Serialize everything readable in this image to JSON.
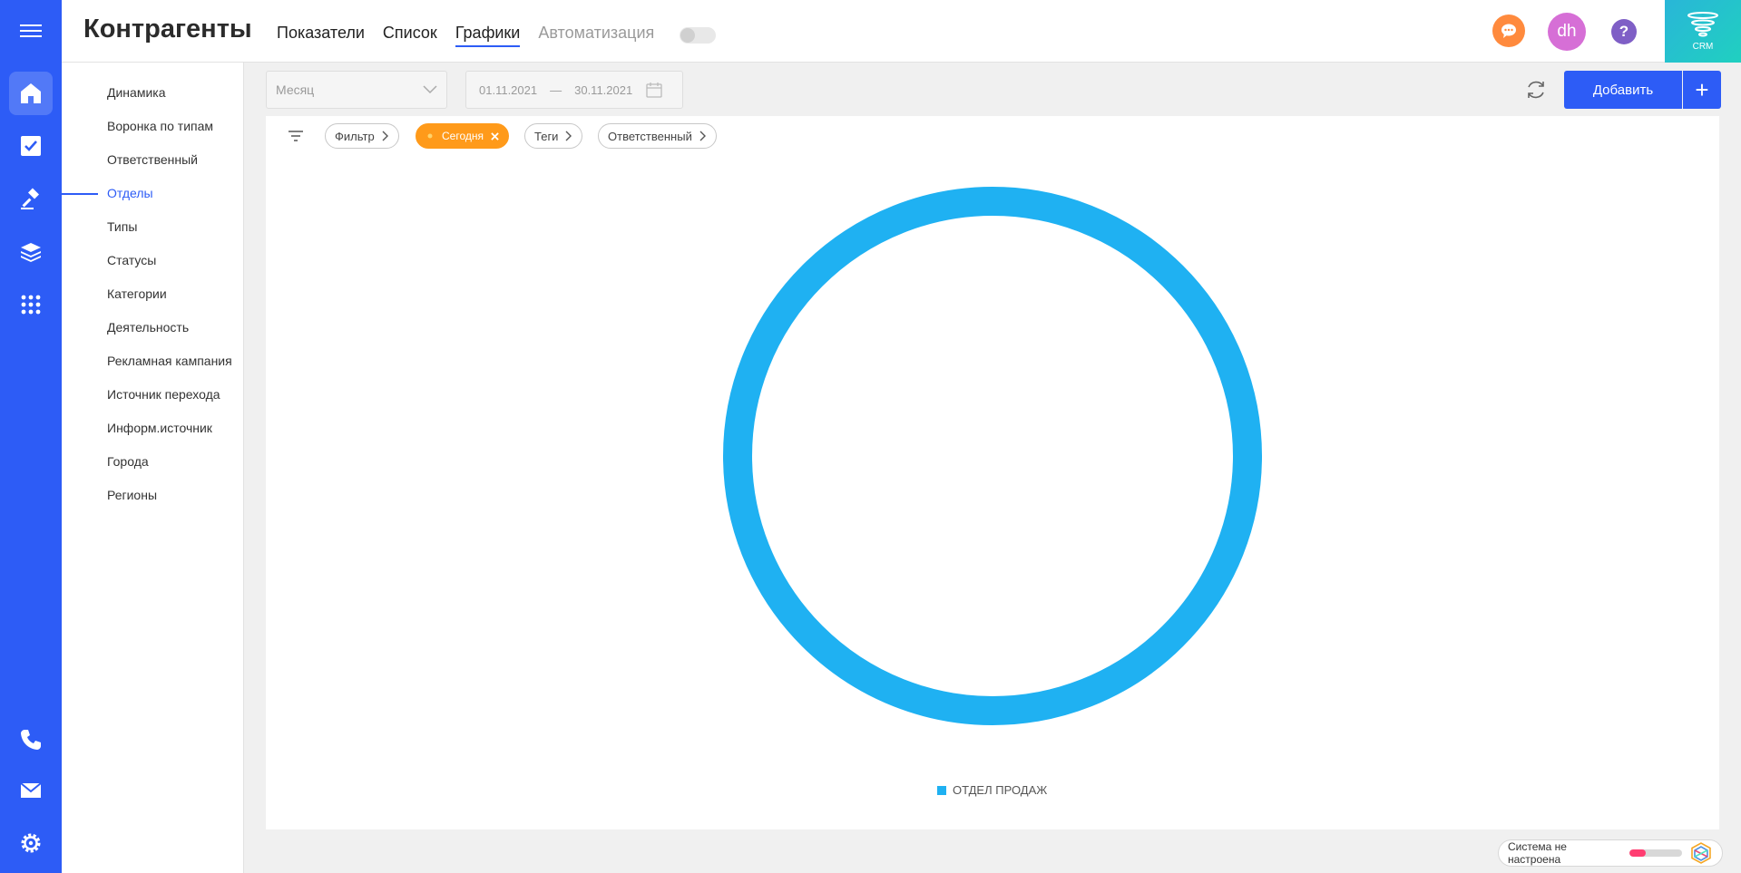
{
  "header": {
    "title": "Контрагенты",
    "tabs": [
      {
        "label": "Показатели"
      },
      {
        "label": "Список"
      },
      {
        "label": "Графики"
      },
      {
        "label": "Автоматизация"
      }
    ],
    "avatar_initials": "dh",
    "help_label": "?",
    "crm_label": "CRM"
  },
  "rail": {
    "icons": [
      "home-icon",
      "tasks-check-icon",
      "gavel-icon",
      "layers-icon",
      "apps-grid-icon",
      "phone-icon",
      "mail-icon",
      "settings-gear-icon"
    ],
    "color": "#2d5cf6"
  },
  "side_menu": {
    "items": [
      {
        "label": "Динамика"
      },
      {
        "label": "Воронка по типам"
      },
      {
        "label": "Ответственный"
      },
      {
        "label": "Отделы"
      },
      {
        "label": "Типы"
      },
      {
        "label": "Статусы"
      },
      {
        "label": "Категории"
      },
      {
        "label": "Деятельность"
      },
      {
        "label": "Рекламная кампания"
      },
      {
        "label": "Источник перехода"
      },
      {
        "label": "Информ.источник"
      },
      {
        "label": "Города"
      },
      {
        "label": "Регионы"
      }
    ],
    "active": "Отделы"
  },
  "toolbar": {
    "period_placeholder": "Месяц",
    "date_from": "01.11.2021",
    "date_separator": "—",
    "date_to": "30.11.2021",
    "add_label": "Добавить",
    "add_plus": "+"
  },
  "filters": {
    "chips": [
      {
        "label": "Фильтр"
      },
      {
        "label": "Сегодня",
        "active": true
      },
      {
        "label": "Теги"
      },
      {
        "label": "Ответственный"
      }
    ],
    "active_color": "#ff9a1a"
  },
  "chart_data": {
    "type": "pie",
    "style": "donut",
    "categories": [
      "ОТДЕЛ ПРОДАЖ"
    ],
    "values": [
      100
    ],
    "colors": [
      "#1fb1f2"
    ],
    "legend": "bottom-center"
  },
  "status": {
    "text": "Система не настроена",
    "progress": 0.3,
    "color": "#ff3d71"
  }
}
